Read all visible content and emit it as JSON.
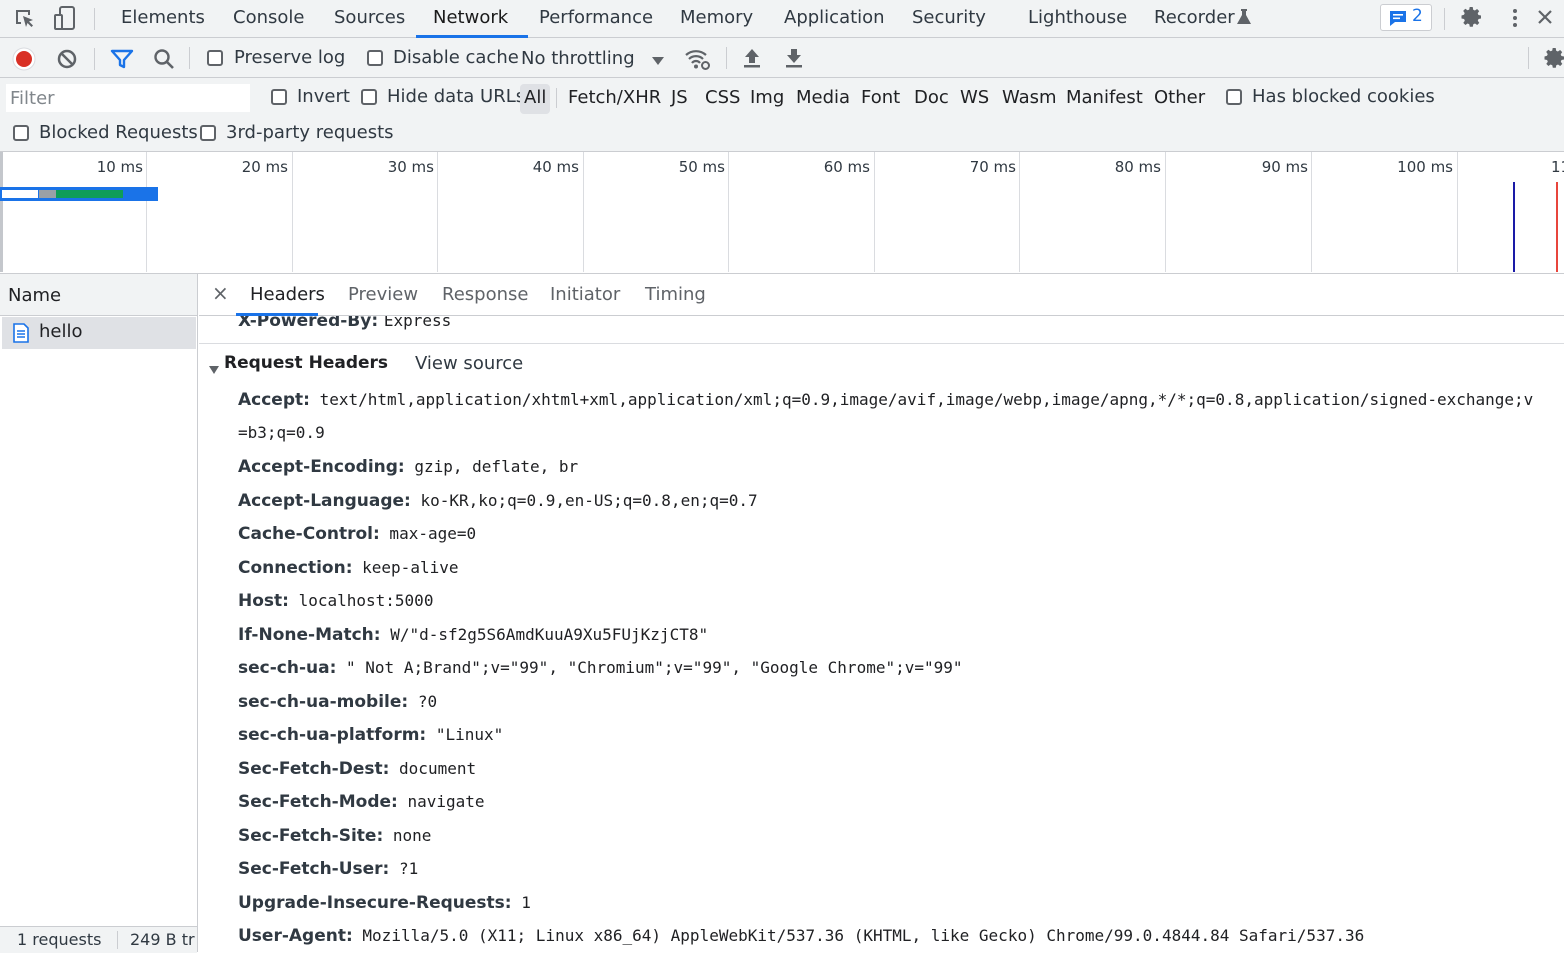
{
  "topbar": {
    "tabs": [
      "Elements",
      "Console",
      "Sources",
      "Network",
      "Performance",
      "Memory",
      "Application",
      "Security",
      "Lighthouse",
      "Recorder"
    ],
    "active_tab": "Network",
    "issues_count": "2"
  },
  "toolbar": {
    "preserve_log": "Preserve log",
    "disable_cache": "Disable cache",
    "throttling": "No throttling"
  },
  "filterbar": {
    "placeholder": "Filter",
    "invert": "Invert",
    "hide_data_urls": "Hide data URLs",
    "types": [
      "All",
      "Fetch/XHR",
      "JS",
      "CSS",
      "Img",
      "Media",
      "Font",
      "Doc",
      "WS",
      "Wasm",
      "Manifest",
      "Other"
    ],
    "selected_type": "All",
    "has_blocked_cookies": "Has blocked cookies",
    "blocked_requests": "Blocked Requests",
    "third_party": "3rd-party requests"
  },
  "timeline": {
    "ticks": [
      "10 ms",
      "20 ms",
      "30 ms",
      "40 ms",
      "50 ms",
      "60 ms",
      "70 ms",
      "80 ms",
      "90 ms",
      "100 ms",
      "11"
    ],
    "colors": {
      "dom_content_loaded": "#1a1aa6",
      "load": "#e8453c",
      "waiting": "#0f9d58",
      "bar": "#1a73e8"
    }
  },
  "requests": {
    "header": "Name",
    "items": [
      {
        "name": "hello"
      }
    ],
    "status": {
      "count": "1 requests",
      "transferred": "249 B tr"
    }
  },
  "detail": {
    "close": "×",
    "tabs": [
      "Headers",
      "Preview",
      "Response",
      "Initiator",
      "Timing"
    ],
    "active_tab": "Headers",
    "prev_header": {
      "name": "X-Powered-By:",
      "value": "Express"
    },
    "section_title": "Request Headers",
    "view_source": "View source",
    "request_headers": [
      {
        "name": "Accept:",
        "value": "text/html,application/xhtml+xml,application/xml;q=0.9,image/avif,image/webp,image/apng,*/*;q=0.8,application/signed-exchange;v",
        "cont": "=b3;q=0.9"
      },
      {
        "name": "Accept-Encoding:",
        "value": "gzip, deflate, br"
      },
      {
        "name": "Accept-Language:",
        "value": "ko-KR,ko;q=0.9,en-US;q=0.8,en;q=0.7"
      },
      {
        "name": "Cache-Control:",
        "value": "max-age=0"
      },
      {
        "name": "Connection:",
        "value": "keep-alive"
      },
      {
        "name": "Host:",
        "value": "localhost:5000"
      },
      {
        "name": "If-None-Match:",
        "value": "W/\"d-sf2g5S6AmdKuuA9Xu5FUjKzjCT8\""
      },
      {
        "name": "sec-ch-ua:",
        "value": "\" Not A;Brand\";v=\"99\", \"Chromium\";v=\"99\", \"Google Chrome\";v=\"99\""
      },
      {
        "name": "sec-ch-ua-mobile:",
        "value": "?0"
      },
      {
        "name": "sec-ch-ua-platform:",
        "value": "\"Linux\""
      },
      {
        "name": "Sec-Fetch-Dest:",
        "value": "document"
      },
      {
        "name": "Sec-Fetch-Mode:",
        "value": "navigate"
      },
      {
        "name": "Sec-Fetch-Site:",
        "value": "none"
      },
      {
        "name": "Sec-Fetch-User:",
        "value": "?1"
      },
      {
        "name": "Upgrade-Insecure-Requests:",
        "value": "1"
      },
      {
        "name": "User-Agent:",
        "value": "Mozilla/5.0 (X11; Linux x86_64) AppleWebKit/537.36 (KHTML, like Gecko) Chrome/99.0.4844.84 Safari/537.36"
      }
    ]
  }
}
